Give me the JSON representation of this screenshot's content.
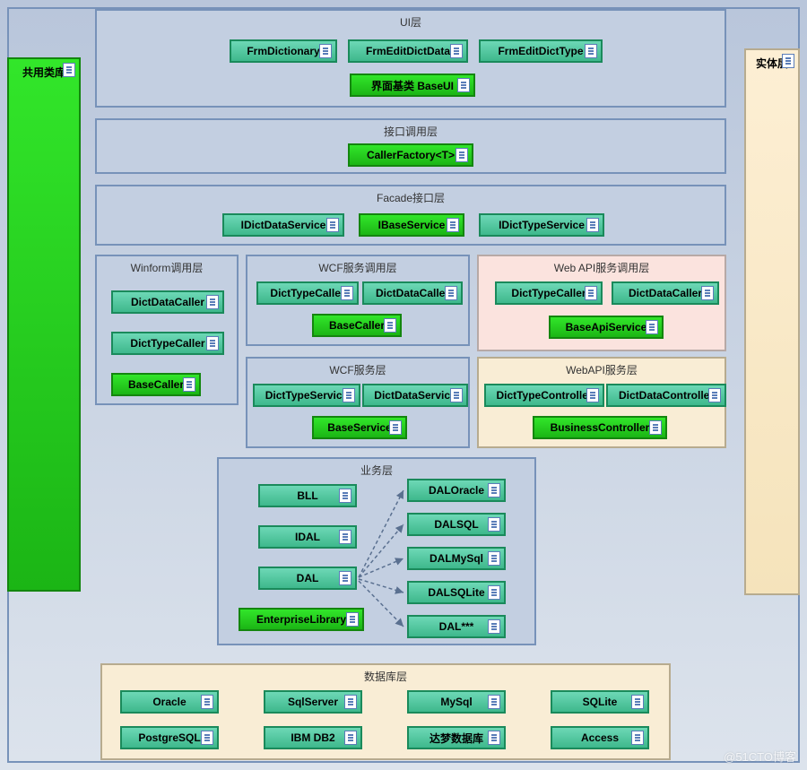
{
  "left_tall": {
    "label": "共用类库"
  },
  "right_tall": {
    "label": "实体层"
  },
  "ui_layer": {
    "title": "UI层",
    "items": [
      "FrmDictionary",
      "FrmEditDictData",
      "FrmEditDictType"
    ],
    "base": "界面基类 BaseUI"
  },
  "interface_call_layer": {
    "title": "接口调用层",
    "item": "CallerFactory<T>"
  },
  "facade_layer": {
    "title": "Facade接口层",
    "items": [
      "IDictDataService",
      "IBaseService",
      "IDictTypeService"
    ]
  },
  "winform_call": {
    "title": "Winform调用层",
    "items": [
      "DictDataCaller",
      "DictTypeCaller"
    ],
    "base": "BaseCaller"
  },
  "wcf_call": {
    "title": "WCF服务调用层",
    "items": [
      "DictTypeCaller",
      "DictDataCaller"
    ],
    "base": "BaseCaller"
  },
  "webapi_call": {
    "title": "Web API服务调用层",
    "items": [
      "DictTypeCaller",
      "DictDataCaller"
    ],
    "base": "BaseApiService"
  },
  "wcf_service": {
    "title": "WCF服务层",
    "items": [
      "DictTypeService",
      "DictDataService"
    ],
    "base": "BaseService"
  },
  "webapi_service": {
    "title": "WebAPI服务层",
    "items": [
      "DictTypeController",
      "DictDataController"
    ],
    "base": "BusinessController"
  },
  "business_layer": {
    "title": "业务层",
    "left": [
      "BLL",
      "IDAL",
      "DAL"
    ],
    "left_green": "EnterpriseLibrary",
    "right": [
      "DALOracle",
      "DALSQL",
      "DALMySql",
      "DALSQLite",
      "DAL***"
    ]
  },
  "db_layer": {
    "title": "数据库层",
    "row1": [
      "Oracle",
      "SqlServer",
      "MySql",
      "SQLite"
    ],
    "row2": [
      "PostgreSQL",
      "IBM DB2",
      "达梦数据库",
      "Access"
    ]
  },
  "watermark": "@51CTO博客"
}
